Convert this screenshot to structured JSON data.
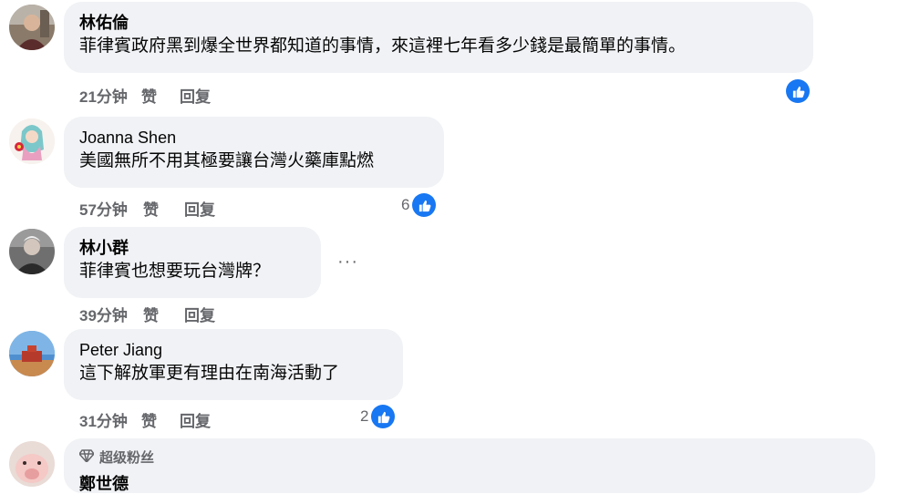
{
  "comments": [
    {
      "author": "林佑倫",
      "text": "菲律賓政府黑到爆全世界都知道的事情，來這裡七年看多少錢是最簡單的事情。",
      "time": "21分钟",
      "like_label": "赞",
      "reply_label": "回复",
      "reaction_count": ""
    },
    {
      "author": "Joanna Shen",
      "text": "美國無所不用其極要讓台灣火藥庫點燃",
      "time": "57分钟",
      "like_label": "赞",
      "reply_label": "回复",
      "reaction_count": "6"
    },
    {
      "author": "林小群",
      "text": "菲律賓也想要玩台灣牌？",
      "time": "39分钟",
      "like_label": "赞",
      "reply_label": "回复",
      "more": "···"
    },
    {
      "author": "Peter Jiang",
      "text": "這下解放軍更有理由在南海活動了",
      "time": "31分钟",
      "like_label": "赞",
      "reply_label": "回复",
      "reaction_count": "2"
    },
    {
      "badge": "超级粉丝",
      "author": "鄭世德"
    }
  ],
  "colors": {
    "like_blue": "#1877f2",
    "bubble": "#f0f2f5",
    "secondary_text": "#65676b"
  },
  "icons": {
    "reaction": "thumbs-up-icon",
    "badge": "diamond-icon",
    "more": "ellipsis-icon"
  }
}
